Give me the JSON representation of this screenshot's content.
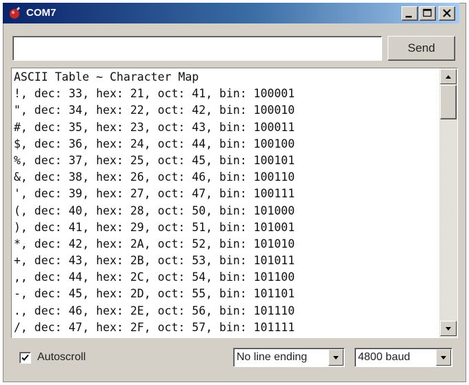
{
  "window": {
    "title": "COM7",
    "app_icon": "arduino-icon"
  },
  "title_buttons": {
    "minimize": "minimize-icon",
    "maximize": "maximize-icon",
    "close": "close-icon"
  },
  "input": {
    "value": ""
  },
  "send_label": "Send",
  "output": {
    "lines": [
      "ASCII Table ~ Character Map",
      "!, dec: 33, hex: 21, oct: 41, bin: 100001",
      "\", dec: 34, hex: 22, oct: 42, bin: 100010",
      "#, dec: 35, hex: 23, oct: 43, bin: 100011",
      "$, dec: 36, hex: 24, oct: 44, bin: 100100",
      "%, dec: 37, hex: 25, oct: 45, bin: 100101",
      "&, dec: 38, hex: 26, oct: 46, bin: 100110",
      "', dec: 39, hex: 27, oct: 47, bin: 100111",
      "(, dec: 40, hex: 28, oct: 50, bin: 101000",
      "), dec: 41, hex: 29, oct: 51, bin: 101001",
      "*, dec: 42, hex: 2A, oct: 52, bin: 101010",
      "+, dec: 43, hex: 2B, oct: 53, bin: 101011",
      ",, dec: 44, hex: 2C, oct: 54, bin: 101100",
      "-, dec: 45, hex: 2D, oct: 55, bin: 101101",
      "., dec: 46, hex: 2E, oct: 56, bin: 101110",
      "/, dec: 47, hex: 2F, oct: 57, bin: 101111"
    ]
  },
  "footer": {
    "autoscroll_label": "Autoscroll",
    "autoscroll_checked": true,
    "line_ending": "No line ending",
    "baud": "4800 baud"
  },
  "colors": {
    "titlebar_start": "#0a246a",
    "titlebar_end": "#a6caf0",
    "chrome": "#d4d0c8"
  }
}
